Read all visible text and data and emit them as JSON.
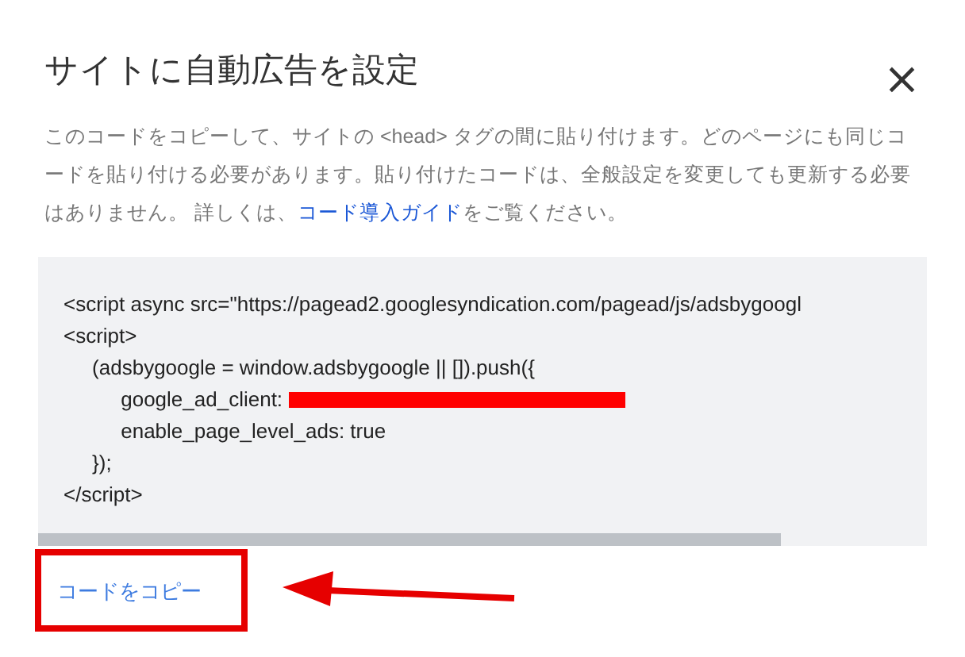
{
  "dialog": {
    "title": "サイトに自動広告を設定",
    "close": "×",
    "description": {
      "before": "このコードをコピーして、サイトの <head> タグの間に貼り付けます。どのページにも同じコードを貼り付ける必要があります。貼り付けたコードは、全般設定を変更しても更新する必要はありません。 詳しくは、",
      "link": "コード導入ガイド",
      "after": "をご覧ください。"
    },
    "code_lines": [
      {
        "kind": "plain",
        "text": "<script async src=\"https://pagead2.googlesyndication.com/pagead/js/adsbygoogl"
      },
      {
        "kind": "plain",
        "text": "<script>"
      },
      {
        "kind": "plain",
        "text": "     (adsbygoogle = window.adsbygoogle || []).push({"
      },
      {
        "kind": "redacted",
        "text": "          google_ad_client: "
      },
      {
        "kind": "plain",
        "text": "          enable_page_level_ads: true"
      },
      {
        "kind": "plain",
        "text": "     });"
      },
      {
        "kind": "plain",
        "text": "</script>"
      }
    ],
    "copy_button": "コードをコピー"
  }
}
